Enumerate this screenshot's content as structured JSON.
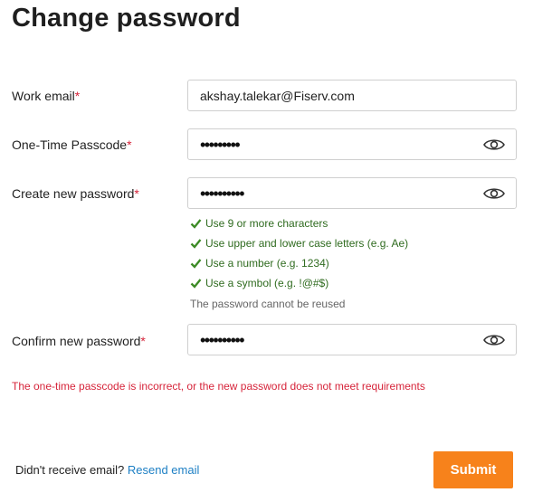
{
  "page": {
    "title": "Change password"
  },
  "form": {
    "email": {
      "label": "Work email",
      "required_mark": "*",
      "value": "akshay.talekar@Fiserv.com"
    },
    "passcode": {
      "label": "One-Time Passcode",
      "required_mark": "*",
      "masked_value": "•••••••••",
      "toggle_icon": "eye-icon"
    },
    "new_password": {
      "label": "Create new password",
      "required_mark": "*",
      "masked_value": "••••••••••",
      "toggle_icon": "eye-icon"
    },
    "requirements": [
      {
        "text": "Use 9 or more characters",
        "met": true
      },
      {
        "text": "Use upper and lower case letters (e.g. Ae)",
        "met": true
      },
      {
        "text": "Use a number (e.g. 1234)",
        "met": true
      },
      {
        "text": "Use a symbol (e.g. !@#$)",
        "met": true
      }
    ],
    "reuse_note": "The password cannot be reused",
    "confirm_password": {
      "label": "Confirm new password",
      "required_mark": "*",
      "masked_value": "••••••••••",
      "toggle_icon": "eye-icon"
    },
    "error_message": "The one-time passcode is incorrect, or the new password does not meet requirements"
  },
  "footer": {
    "prompt": "Didn't receive email?",
    "resend_link": "Resend email",
    "submit_label": "Submit"
  },
  "colors": {
    "accent": "#f7821b",
    "error": "#d6243a",
    "success": "#2f6b1f",
    "link": "#1d7fc4"
  }
}
